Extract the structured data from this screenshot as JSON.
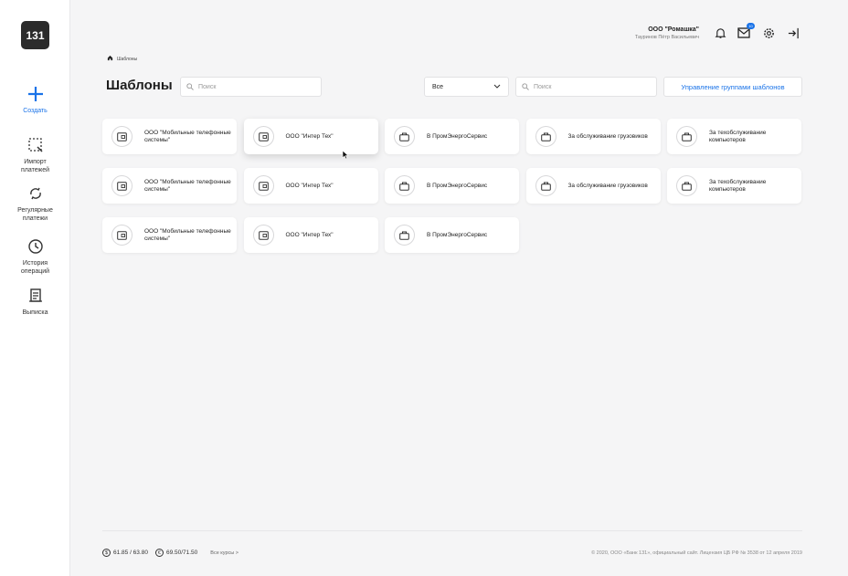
{
  "sidebar": {
    "logo": "131",
    "create": "Создать",
    "import": "Импорт\nплатежей",
    "regular": "Регулярные\nплатежи",
    "history": "История\nопераций",
    "statement": "Выписка"
  },
  "header": {
    "company_name": "ООО \"Ромашка\"",
    "user_name": "Тауринов Пётр Васильевич",
    "messages_count": "10"
  },
  "breadcrumb": {
    "current": "Шаблоны"
  },
  "page": {
    "title": "Шаблоны",
    "search_placeholder": "Поиск",
    "filter_value": "Все",
    "filter_search_placeholder": "Поиск",
    "manage_groups": "Управление группами шаблонов"
  },
  "templates": [
    {
      "label": "ООО \"Мобильные телефонные системы\"",
      "icon": "wallet-icon"
    },
    {
      "label": "ООО \"Интер Тех\"",
      "icon": "wallet-icon"
    },
    {
      "label": "В ПромЭнергоСервис",
      "icon": "briefcase-icon"
    },
    {
      "label": "За обслуживание грузовиков",
      "icon": "briefcase-icon"
    },
    {
      "label": "За техобслуживание компьютеров",
      "icon": "briefcase-icon"
    },
    {
      "label": "ООО \"Мобильные телефонные системы\"",
      "icon": "wallet-icon"
    },
    {
      "label": "ООО \"Интер Тех\"",
      "icon": "wallet-icon"
    },
    {
      "label": "В ПромЭнергоСервис",
      "icon": "briefcase-icon"
    },
    {
      "label": "За обслуживание грузовиков",
      "icon": "briefcase-icon"
    },
    {
      "label": "За техобслуживание компьютеров",
      "icon": "briefcase-icon"
    },
    {
      "label": "ООО \"Мобильные телефонные системы\"",
      "icon": "wallet-icon"
    },
    {
      "label": "ООО \"Интер Тех\"",
      "icon": "wallet-icon"
    },
    {
      "label": "В ПромЭнергоСервис",
      "icon": "briefcase-icon"
    }
  ],
  "footer": {
    "usd_symbol": "$",
    "usd_rate": "61.85 / 63.80",
    "eur_symbol": "€",
    "eur_rate": "69.50/71.50",
    "all_rates": "Все курсы >",
    "copyright": "© 2020, ООО «Банк 131», официальный сайт. Лицензия ЦБ РФ № 3538 от 12 апреля 2019"
  },
  "colors": {
    "accent": "#1a73e8",
    "background": "#f5f5f6"
  }
}
